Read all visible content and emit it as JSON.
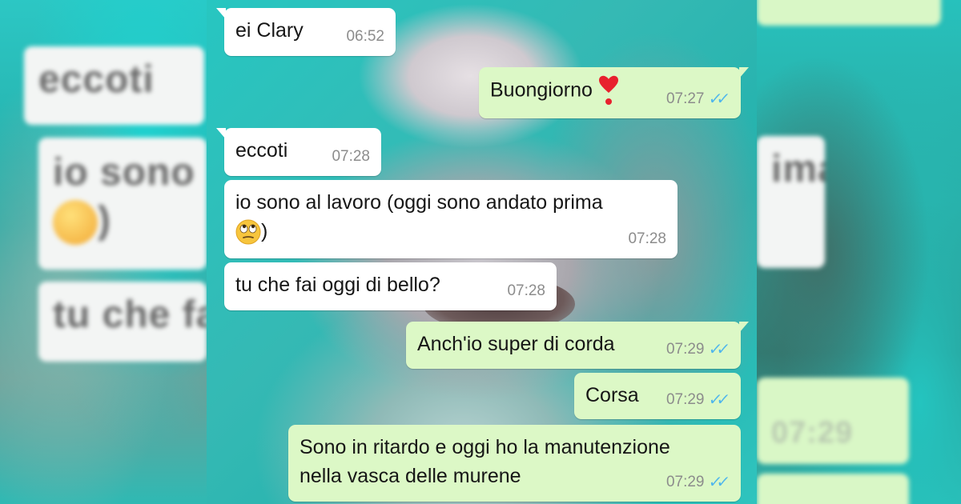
{
  "left_panel": {
    "blurred_texts": [
      "eccoti",
      "io sono a",
      ")",
      "tu che fa"
    ]
  },
  "right_panel": {
    "blurred_texts": [
      "ima",
      "07:29"
    ]
  },
  "messages": [
    {
      "id": "m1",
      "direction": "in",
      "text": "ei Clary",
      "time": "06:52"
    },
    {
      "id": "m2",
      "direction": "out",
      "text": "Buongiorno",
      "emoji": "heart-exclamation",
      "time": "07:27",
      "status": "read"
    },
    {
      "id": "m3",
      "direction": "in",
      "text": "eccoti",
      "time": "07:28"
    },
    {
      "id": "m4",
      "direction": "in",
      "text_line1": "io sono al lavoro (oggi sono andato prima",
      "text_line2": ")",
      "emoji": "face-with-rolling-eyes",
      "time": "07:28"
    },
    {
      "id": "m5",
      "direction": "in",
      "text": "tu che fai oggi di bello?",
      "time": "07:28"
    },
    {
      "id": "m6",
      "direction": "out",
      "text": "Anch'io super di corda",
      "time": "07:29",
      "status": "read"
    },
    {
      "id": "m7",
      "direction": "out",
      "text": "Corsa",
      "time": "07:29",
      "status": "read"
    },
    {
      "id": "m8",
      "direction": "out",
      "text_line1": "Sono in ritardo e oggi ho la manutenzione",
      "text_line2": "nella vasca delle murene",
      "time": "07:29",
      "status": "read"
    }
  ],
  "colors": {
    "incoming_bubble": "#ffffff",
    "outgoing_bubble": "#dcf8c6",
    "read_ticks": "#4fb6ec",
    "timestamp": "#8c8c8c"
  }
}
